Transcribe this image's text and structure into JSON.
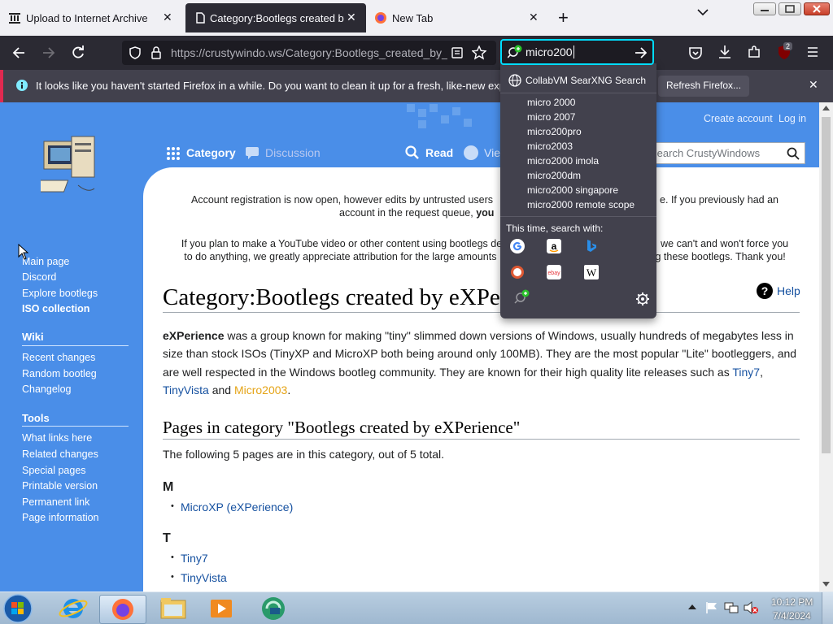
{
  "browser": {
    "tabs": [
      {
        "label": "Upload to Internet Archive",
        "close": "✕"
      },
      {
        "label": "Category:Bootlegs created by eX",
        "close": "✕"
      },
      {
        "label": "New Tab",
        "close": "✕"
      }
    ],
    "new_tab": "+",
    "tab_list": "⌄",
    "url": "https://crustywindo.ws/Category:Bootlegs_created_by_eXPerience",
    "search_value": "micro200",
    "extension_badge": "2"
  },
  "notification": {
    "text": "It looks like you haven't started Firefox in a while. Do you want to clean it up for a fresh, like-new experience?",
    "button": "Refresh Firefox...",
    "close": "✕"
  },
  "search_dropdown": {
    "engine_label": "CollabVM SearXNG Search",
    "suggestions": [
      "micro 2000",
      "micro 2007",
      "micro200pro",
      "micro2003",
      "micro2000 imola",
      "micro200dm",
      "micro2000 singapore",
      "micro2000 remote scope"
    ],
    "this_time_label": "This time, search with:",
    "engines": [
      "google-icon",
      "amazon-icon",
      "bing-icon",
      "duckduckgo-icon",
      "ebay-icon",
      "wikipedia-icon",
      "collabvm-searxng-icon"
    ]
  },
  "wiki": {
    "top_links": {
      "create_account": "Create account",
      "login": "Log in"
    },
    "tabs": {
      "category": "Category",
      "discussion": "Discussion",
      "read": "Read",
      "view": "View"
    },
    "search_placeholder": "Search CrustyWindows",
    "sidebar": {
      "main": [
        "Main page",
        "Discord",
        "Explore bootlegs",
        "ISO collection"
      ],
      "wiki_heading": "Wiki",
      "wiki": [
        "Recent changes",
        "Random bootleg",
        "Changelog"
      ],
      "tools_heading": "Tools",
      "tools": [
        "What links here",
        "Related changes",
        "Special pages",
        "Printable version",
        "Permanent link",
        "Page information"
      ]
    },
    "notice1_line1_a": "Account registration is now open, however edits by untrusted users",
    "notice1_line1_b": "e. If you previously had an",
    "notice1_line2_a": "account in the request queue,",
    "notice1_line2_b": "you",
    "notice2_line1_a": "If you plan to make a YouTube video or other content using bootlegs de",
    "notice2_line1_b": "we can't and won't force you",
    "notice2_line2_a": "to do anything, we greatly appreciate attribution for the large amounts",
    "notice2_line2_b": "g these bootlegs. Thank you!",
    "title": "Category:Bootlegs created by eXPerience",
    "help": "Help",
    "para_bold": "eXPerience",
    "para_text": " was a group known for making \"tiny\" slimmed down versions of Windows, usually hundreds of megabytes less in size than stock ISOs (TinyXP and MicroXP both being around only 100MB). They are the most popular \"Lite\" bootleggers, and are well respected in the Windows bootleg community. They are known for their high quality lite releases such as ",
    "link_tiny7": "Tiny7",
    "comma": ", ",
    "link_tinyvista": "TinyVista",
    "and": " and ",
    "link_micro2003": "Micro2003",
    "period": ".",
    "pages_heading": "Pages in category \"Bootlegs created by eXPerience\"",
    "pages_count": "The following 5 pages are in this category, out of 5 total.",
    "groups": [
      {
        "letter": "M",
        "items": [
          "MicroXP (eXPerience)"
        ]
      },
      {
        "letter": "T",
        "items": [
          "Tiny7",
          "TinyVista"
        ]
      }
    ]
  },
  "taskbar": {
    "time": "10:12 PM",
    "date": "7/4/2024"
  },
  "colors": {
    "accent": "#00ddff",
    "wiki_blue": "#4a8ee8",
    "link": "#1651a0",
    "visited": "#e5a417"
  }
}
